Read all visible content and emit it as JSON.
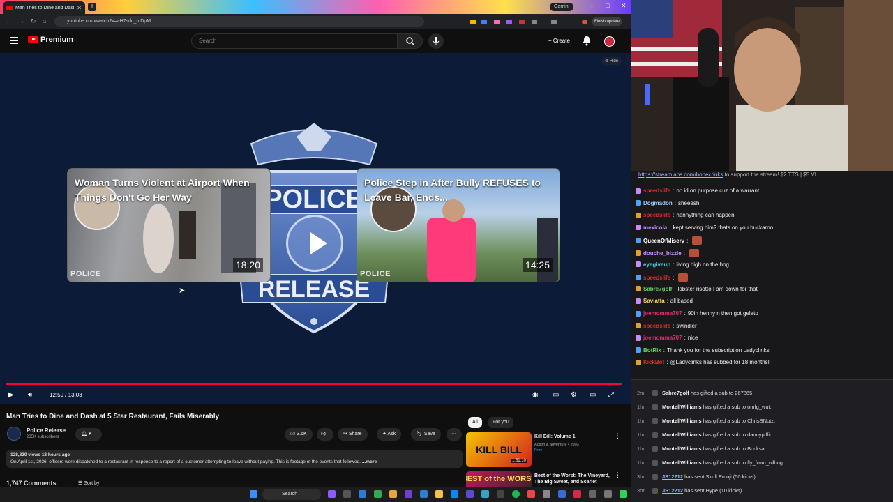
{
  "browser": {
    "tab_title": "Man Tries to Dine and Dash at",
    "url": "youtube.com/watch?v=aH7sdc_mDpM",
    "gemini_label": "Gemini",
    "finish_update": "Finish update"
  },
  "youtube": {
    "logo_text": "Premium",
    "search_placeholder": "Search",
    "create_label": "Create"
  },
  "player": {
    "hide_label": "Hide",
    "card_left": {
      "title": "Woman Turns Violent at Airport When Things Don't Go Her Way",
      "duration": "18:20",
      "watermark": "POLICE"
    },
    "card_right": {
      "title": "Police Step in After Bully REFUSES to Leave Bar, Ends...",
      "duration": "14:25",
      "watermark": "POLICE"
    },
    "time": "12:59 / 13:03",
    "progress": 0.995
  },
  "video": {
    "title": "Man Tries to Dine and Dash at 5 Star Restaurant, Fails Miserably",
    "channel": "Police Release",
    "subscribers": "235K subscribers",
    "likes": "3.6K",
    "share": "Share",
    "ask": "Ask",
    "save": "Save",
    "views_line": "128,820 views  18 hours ago",
    "description": "On April 1st, 2026, officers were dispatched to a restaurant in response to a report of a customer attempting to leave without paying. This is footage of the events that followed.",
    "more": "...more",
    "comments": "1,747 Comments",
    "sort_by": "Sort by"
  },
  "recommendations": {
    "chips": [
      "All",
      "For you"
    ],
    "items": [
      {
        "title": "Kill Bill: Volume 1",
        "meta1": "Action & adventure • 2003",
        "meta2": "Free",
        "duration": "1:51:10"
      },
      {
        "title": "Best of the Worst: The Vineyard, The Big Sweat, and Scarlet",
        "meta1": "",
        "meta2": "",
        "duration": ""
      }
    ]
  },
  "chat": {
    "banner_link": "https://streamlabs.com/bonecrinks",
    "banner_rest": " to support the stream! $2 TTS | $5 VI...",
    "messages": [
      {
        "user": "speedslife",
        "text": "no id on purpose cuz of a warrant",
        "color": "#e02c2c"
      },
      {
        "user": "Dogmadon",
        "text": "sheeesh",
        "color": "#9bd1ff"
      },
      {
        "user": "speedslife",
        "text": "hennything can happen",
        "color": "#e02c2c"
      },
      {
        "user": "mexicola",
        "text": "kept serving him? thats on you buckaroo",
        "color": "#c58cff"
      },
      {
        "user": "QueenOfMisery",
        "text": "",
        "color": "#ffffff"
      },
      {
        "user": "douche_bizzle",
        "text": "",
        "color": "#c58cff"
      },
      {
        "user": "eyegiveup",
        "text": "living high on the hog",
        "color": "#4dd0e1"
      },
      {
        "user": "speedslife",
        "text": "",
        "color": "#e02c2c"
      },
      {
        "user": "Sabre7golf",
        "text": "lobster risotto I am down for that",
        "color": "#5fd35f"
      },
      {
        "user": "Saviatta",
        "text": "all based",
        "color": "#ffd54f"
      },
      {
        "user": "joemomma707",
        "text": "90in henny n then got gelato",
        "color": "#e02c6c"
      },
      {
        "user": "speedslife",
        "text": "swindler",
        "color": "#e02c2c"
      },
      {
        "user": "joemomma707",
        "text": "nice",
        "color": "#e02c6c"
      },
      {
        "user": "BotRix",
        "text": "Thank you for the subscription Ladyclinks",
        "color": "#5fd35f"
      },
      {
        "user": "KickBot",
        "text": "@Ladyclinks has subbed for 18 months!",
        "color": "#e02c2c"
      }
    ]
  },
  "events": [
    {
      "ago": "2m",
      "who": "Sabre7golf",
      "text": " has gifted a sub to 267865."
    },
    {
      "ago": "1hr",
      "who": "MontellWilliams",
      "text": " has gifted a sub to omfg_wut."
    },
    {
      "ago": "1hr",
      "who": "MontellWilliams",
      "text": " has gifted a sub to ChrisBNutz."
    },
    {
      "ago": "1hr",
      "who": "MontellWilliams",
      "text": " has gifted a sub to dannypiffin."
    },
    {
      "ago": "1hr",
      "who": "MontellWilliams",
      "text": " has gifted a sub to Bocksar."
    },
    {
      "ago": "1hr",
      "who": "MontellWilliams",
      "text": " has gifted a sub to fly_from_nilbog."
    },
    {
      "ago": "3hr",
      "who": "JS12212",
      "text": " has sent Skull Emoji (50 kicks)"
    },
    {
      "ago": "3hr",
      "who": "JS12212",
      "text": " has sent Hype (10 kicks)"
    }
  ],
  "taskbar": {
    "search_label": "Search"
  }
}
